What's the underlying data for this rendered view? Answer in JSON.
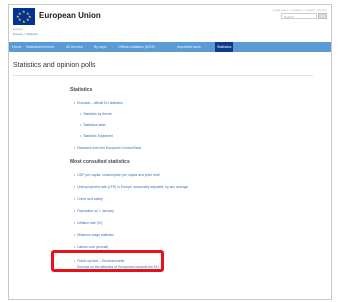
{
  "header": {
    "brand_title": "European Union",
    "brand_sub": "Europa",
    "top_links": "Legal notice | Cookies | Contact | Search",
    "search_placeholder": "Search",
    "breadcrumb": "Europa > Statistics"
  },
  "nav": {
    "items": [
      {
        "label": "Home"
      },
      {
        "label": "Statistical themes"
      },
      {
        "label": "All themes"
      },
      {
        "label": "By topic"
      },
      {
        "label": "Official statistics (MOS)"
      },
      {
        "label": "Important facts"
      },
      {
        "label": "Statistics"
      }
    ]
  },
  "main": {
    "page_title": "Statistics and opinion polls",
    "sections": [
      {
        "heading": "Statistics",
        "items": [
          {
            "label": "Eurostat – official EU statistics",
            "level": 1
          },
          {
            "label": "Statistics by theme",
            "level": 2
          },
          {
            "label": "Statistical atlas",
            "level": 2
          },
          {
            "label": "Statistics Explained",
            "level": 2
          },
          {
            "label": "Research from the European Central Bank",
            "level": 1
          }
        ]
      },
      {
        "heading": "Most consulted statistics",
        "items": [
          {
            "label": "GDP per capita, consumption per capita and price level",
            "level": 1
          },
          {
            "label": "Unemployment rate (LFS) in Europe, seasonally adjusted, by sex and age",
            "level": 1
          },
          {
            "label": "Crime and safety",
            "level": 1
          },
          {
            "label": "Population on 1 January",
            "level": 1
          },
          {
            "label": "Inflation rate (%)",
            "level": 1
          },
          {
            "label": "Minimum wage statistics",
            "level": 1
          },
          {
            "label": "Labour cost (annual)",
            "level": 1
          }
        ]
      }
    ],
    "highlight_item": {
      "label_line1": "Public opinion – Eurobarometer",
      "label_line2": "Surveys on the attitudes of Europeans towards the EU"
    }
  }
}
